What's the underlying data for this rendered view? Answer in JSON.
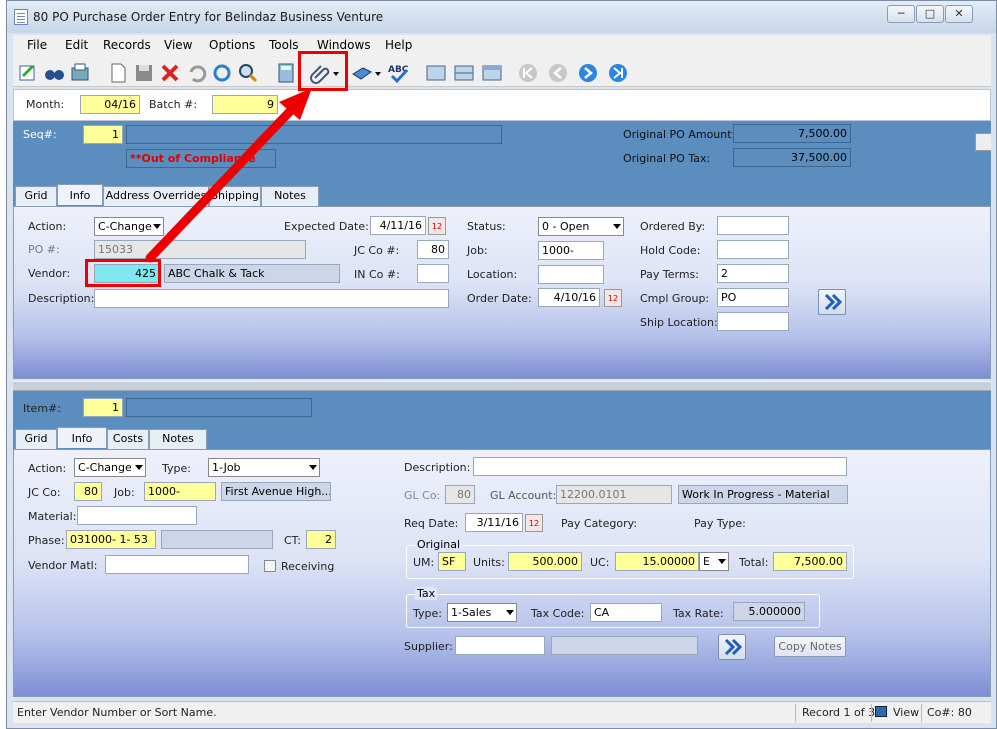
{
  "window": {
    "title": "80 PO Purchase Order Entry for Belindaz Business Venture"
  },
  "menu": [
    "File",
    "Edit",
    "Records",
    "View",
    "Options",
    "Tools",
    "Windows",
    "Help"
  ],
  "header": {
    "month_label": "Month:",
    "month_value": "04/16",
    "batch_label": "Batch #:",
    "batch_value": "9"
  },
  "po_header": {
    "seq_label": "Seq#:",
    "seq_value": "1",
    "compliance": "**Out of Compliance",
    "orig_amount_label": "Original PO Amount:",
    "orig_amount_value": "7,500.00",
    "orig_tax_label": "Original PO Tax:",
    "orig_tax_value": "37,500.00"
  },
  "tabs_top": [
    "Grid",
    "Info",
    "Address Overrides",
    "Shipping",
    "Notes"
  ],
  "info_top": {
    "action_label": "Action:",
    "action_value": "C-Change",
    "po_label": "PO #:",
    "po_value": "15033",
    "vendor_label": "Vendor:",
    "vendor_value": "425",
    "vendor_name": "ABC Chalk & Tack",
    "desc_label": "Description:",
    "expected_label": "Expected Date:",
    "expected_value": "4/11/16",
    "jcco_label": "JC Co #:",
    "jcco_value": "80",
    "inco_label": "IN Co #:",
    "status_label": "Status:",
    "status_value": "0 - Open",
    "job_label": "Job:",
    "job_value": "1000-",
    "location_label": "Location:",
    "orderdate_label": "Order Date:",
    "orderdate_value": "4/10/16",
    "orderedby_label": "Ordered By:",
    "holdcode_label": "Hold Code:",
    "payterms_label": "Pay Terms:",
    "payterms_value": "2",
    "cmpl_label": "Cmpl Group:",
    "cmpl_value": "PO",
    "shiploc_label": "Ship Location:",
    "cal_icon": "12"
  },
  "item_header": {
    "item_label": "Item#:",
    "item_value": "1"
  },
  "tabs_bottom": [
    "Grid",
    "Info",
    "Costs",
    "Notes"
  ],
  "info_bottom": {
    "action_label": "Action:",
    "action_value": "C-Change",
    "type_label": "Type:",
    "type_value": "1-Job",
    "jcco_label": "JC Co:",
    "jcco_value": "80",
    "job_label": "Job:",
    "job_value": "1000-",
    "job_name": "First Avenue High...",
    "material_label": "Material:",
    "phase_label": "Phase:",
    "phase_value": "031000- 1- 53",
    "ct_label": "CT:",
    "ct_value": "2",
    "vendmatl_label": "Vendor Matl:",
    "receiving_label": "Receiving",
    "desc_label": "Description:",
    "glco_label": "GL Co:",
    "glco_value": "80",
    "glacct_label": "GL Account:",
    "glacct_value": "12200.0101",
    "glacct_desc": "Work In Progress - Material",
    "reqdate_label": "Req Date:",
    "reqdate_value": "3/11/16",
    "paycat_label": "Pay Category:",
    "paytype_label": "Pay Type:",
    "original_group": "Original",
    "um_label": "UM:",
    "um_value": "SF",
    "units_label": "Units:",
    "units_value": "500.000",
    "uc_label": "UC:",
    "uc_value": "15.00000",
    "uc_unit": "E",
    "total_label": "Total:",
    "total_value": "7,500.00",
    "tax_group": "Tax",
    "taxtype_label": "Type:",
    "taxtype_value": "1-Sales",
    "taxcode_label": "Tax Code:",
    "taxcode_value": "CA",
    "taxrate_label": "Tax Rate:",
    "taxrate_value": "5.000000",
    "supplier_label": "Supplier:",
    "copynotes_label": "Copy Notes",
    "cal_icon": "12"
  },
  "status": {
    "message": "Enter Vendor Number or Sort Name.",
    "record": "Record 1 of 3",
    "mode": "View",
    "company": "Co#: 80"
  },
  "colors": {
    "highlight": "#ee0000",
    "band": "#5b8dbe",
    "required": "#ffff99"
  }
}
